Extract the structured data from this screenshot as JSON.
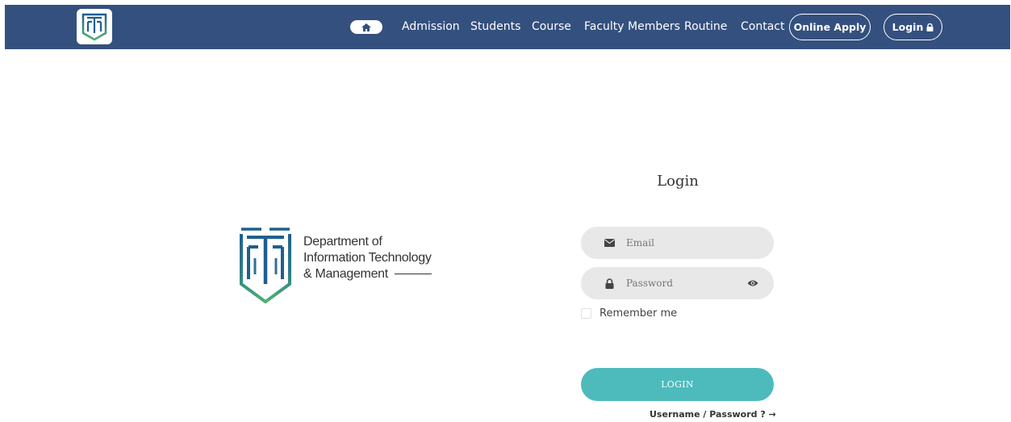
{
  "nav": {
    "home_icon": "home-icon",
    "links": [
      "Admission",
      "Students",
      "Course",
      "Faculty Members",
      "Routine",
      "Contact"
    ],
    "online_apply": "Online Apply",
    "login": "Login",
    "login_icon": "lock-icon"
  },
  "brand": {
    "line1": "Department of",
    "line2": "Information Technology",
    "line3": "& Management"
  },
  "form": {
    "title": "Login",
    "email_placeholder": "Email",
    "password_placeholder": "Password",
    "remember_label": "Remember me",
    "submit_label": "LOGIN",
    "forgot_label": "Username / Password ? →"
  },
  "colors": {
    "navbar": "#34507e",
    "accent": "#4dbbbc",
    "logo_green": "#4fb071",
    "logo_blue": "#1f5f8f"
  }
}
